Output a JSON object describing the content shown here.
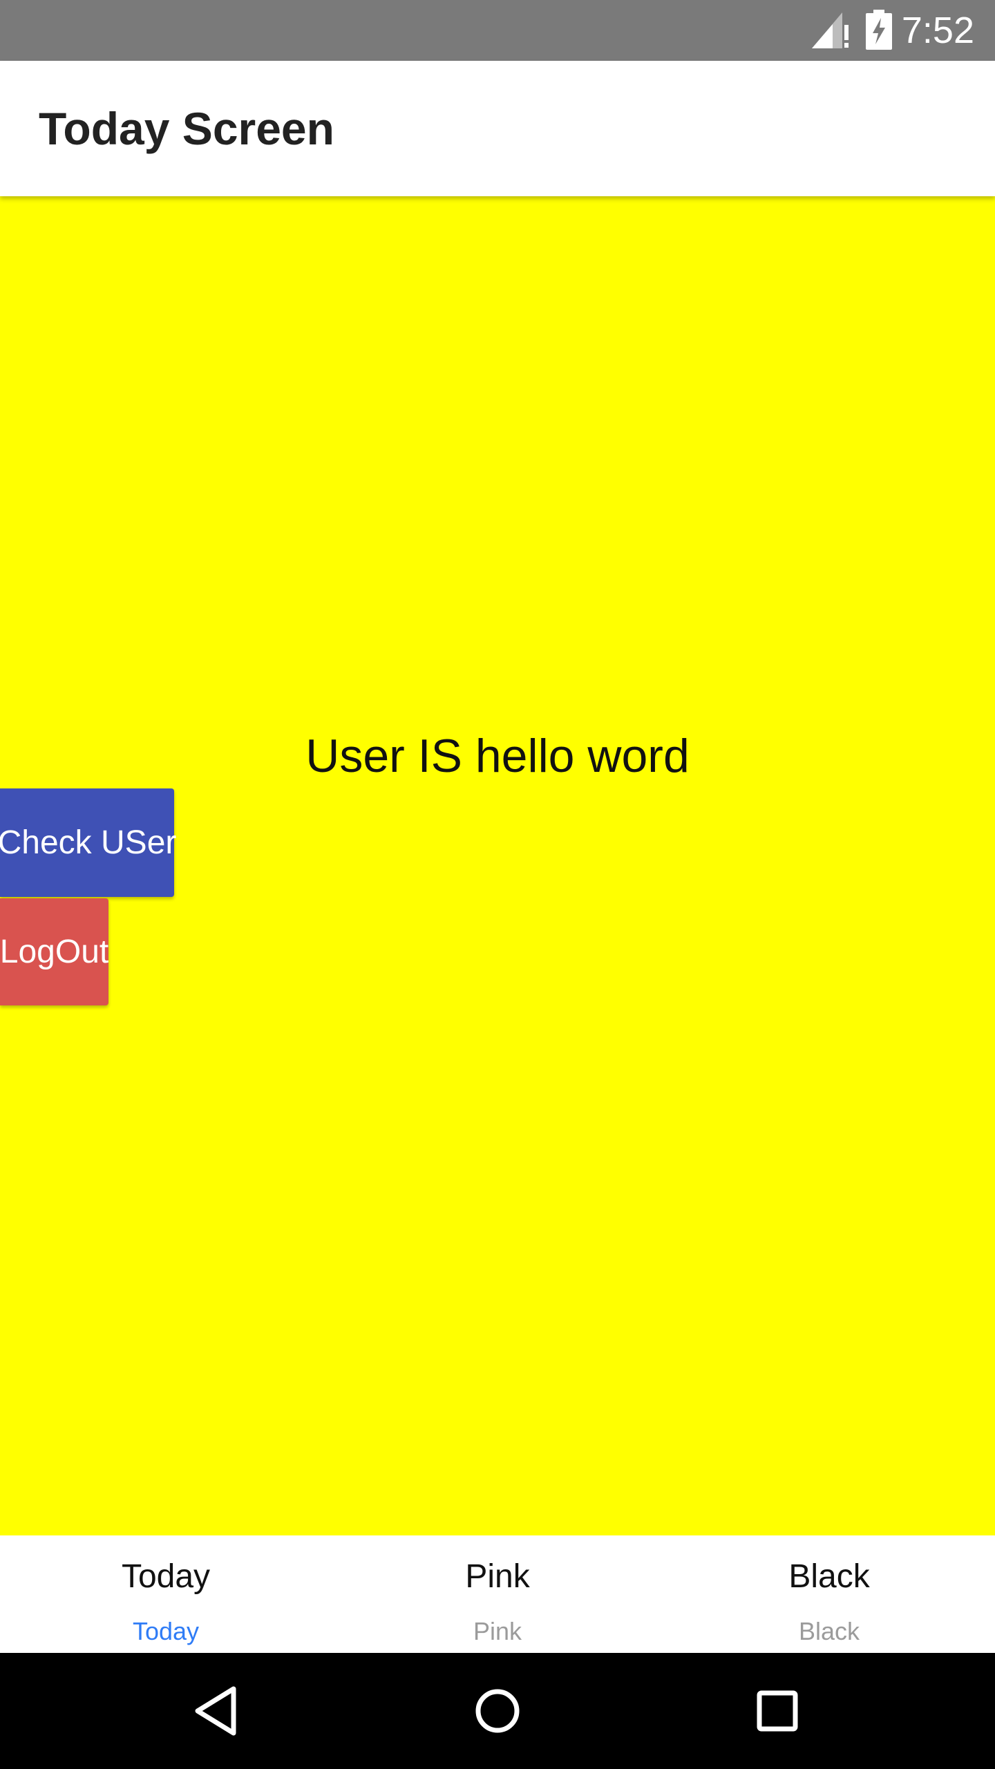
{
  "status_bar": {
    "time": "7:52",
    "icons": [
      "signal-no-data-icon",
      "battery-charging-icon"
    ]
  },
  "app_bar": {
    "title": "Today Screen"
  },
  "content": {
    "message": "User IS hello word",
    "check_user_label": "Check USer",
    "logout_label": "LogOut"
  },
  "tabs": [
    {
      "title": "Today",
      "label": "Today",
      "active": true
    },
    {
      "title": "Pink",
      "label": "Pink",
      "active": false
    },
    {
      "title": "Black",
      "label": "Black",
      "active": false
    }
  ],
  "colors": {
    "status_bar": "#7a7a7a",
    "content_background": "#ffff00",
    "check_user_button": "#3f51b5",
    "logout_button": "#d9534f",
    "active_tab": "#2f7cf6",
    "inactive_tab": "#9b9b9b"
  },
  "nav_bar": {
    "icons": [
      "back-icon",
      "home-icon",
      "recents-icon"
    ]
  }
}
